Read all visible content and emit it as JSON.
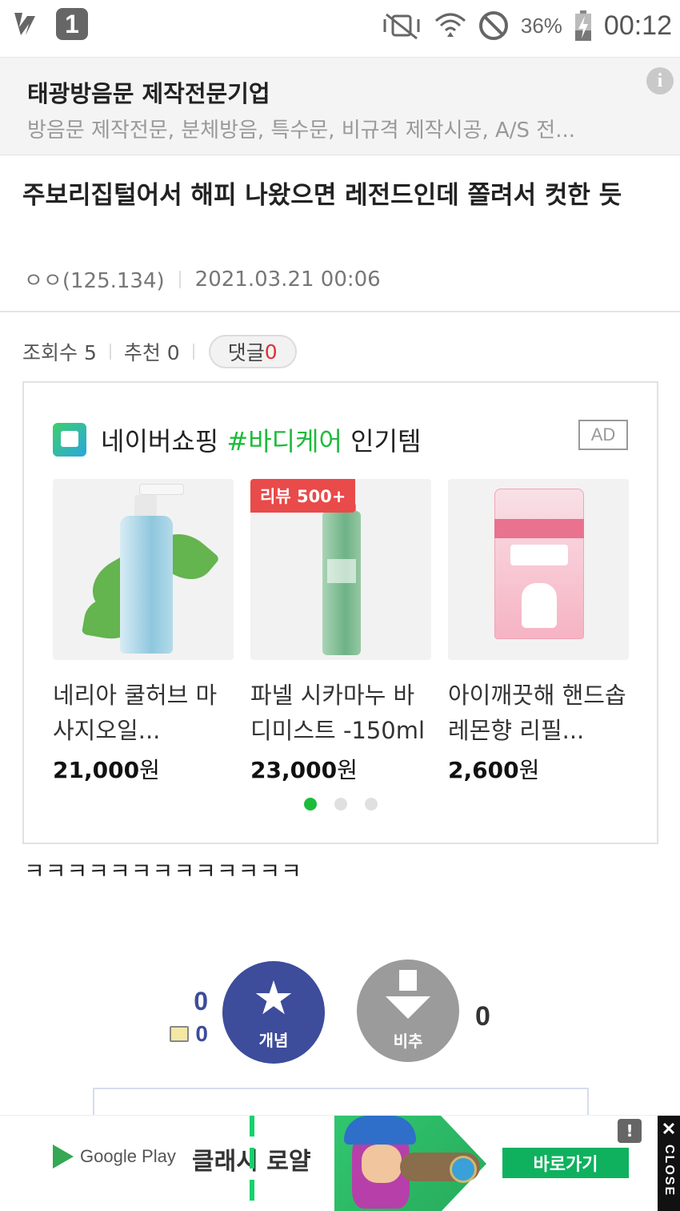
{
  "status_bar": {
    "notification_badge": "1",
    "battery": "36%",
    "time": "00:12"
  },
  "top_ad": {
    "title": "태광방음문 제작전문기업",
    "description": "방음문 제작전문, 분체방음, 특수문, 비규격 제작시공, A/S 전..."
  },
  "post": {
    "title": "주보리집털어서 해피 나왔으면 레전드인데 쫄려서 컷한 듯",
    "author": "ㅇㅇ(125.134)",
    "date": "2021.03.21 00:06",
    "views_label": "조회수 5",
    "recommend_label": "추천 0",
    "comment_label": "댓글",
    "comment_count": "0",
    "body": "ㅋㅋㅋㅋㅋㅋㅋㅋㅋㅋㅋㅋㅋ"
  },
  "shopping_ad": {
    "title_prefix": "네이버쇼핑 ",
    "title_tag": "#바디케어",
    "title_suffix": " 인기템",
    "ad_badge": "AD",
    "review_badge": "리뷰 500+",
    "products": [
      {
        "name": "네리아 쿨허브 마사지오일...",
        "price": "21,000",
        "currency": "원"
      },
      {
        "name": "파넬 시카마누 바디미스트 -150ml",
        "price": "23,000",
        "currency": "원"
      },
      {
        "name": "아이깨끗해 핸드솝 레몬향 리필...",
        "price": "2,600",
        "currency": "원"
      }
    ],
    "carousel_active_index": 0,
    "carousel_pages": 3
  },
  "vote": {
    "up_count": "0",
    "fixed_count": "0",
    "up_label": "개념",
    "down_label": "비추",
    "down_count": "0"
  },
  "bottom_ad": {
    "store": "Google Play",
    "game": "클래시 로얄",
    "cta": "바로가기",
    "close": "CLOSE",
    "close_x": "✕",
    "info": "!"
  }
}
